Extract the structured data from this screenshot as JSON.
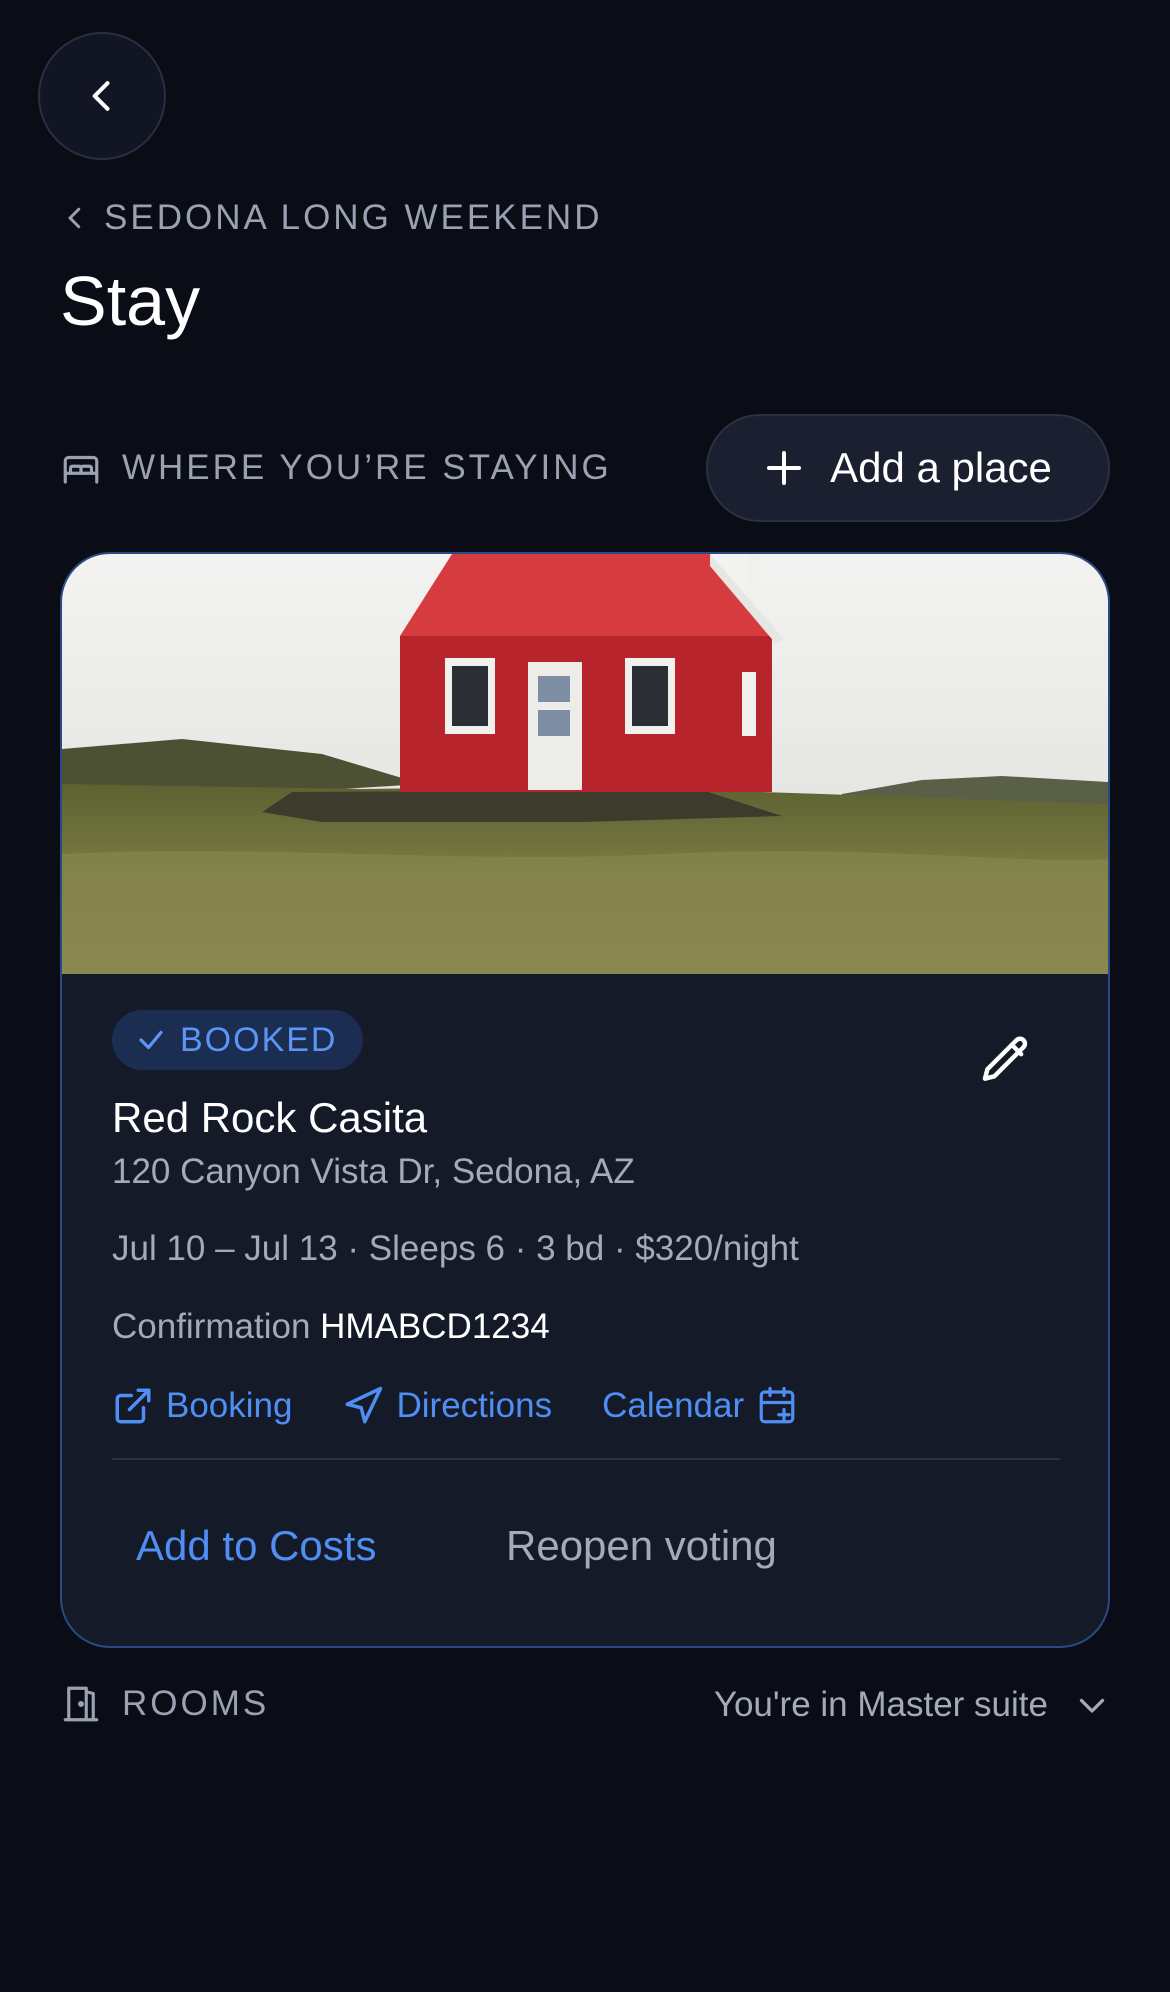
{
  "colors": {
    "background": "#0a0c16",
    "card": "#151a28",
    "card_border": "#2a4a86",
    "accent": "#4f8ef3",
    "muted": "#9aa1b1",
    "badge_bg": "#1c2d52"
  },
  "header": {
    "back_icon": "chevron-left-icon",
    "breadcrumb": "SEDONA LONG WEEKEND",
    "title": "Stay"
  },
  "stay_section": {
    "heading": "WHERE YOU’RE STAYING",
    "heading_icon": "bed-icon",
    "add_button_label": "Add a place",
    "add_button_icon": "plus-icon"
  },
  "stay_card": {
    "status": "BOOKED",
    "name": "Red Rock Casita",
    "address": "120 Canyon Vista Dr, Sedona, AZ",
    "details": "Jul 10 – Jul 13 · Sleeps 6 · 3 bd · $320/night",
    "confirmation_label": "Confirmation",
    "confirmation_code": "HMABCD1234",
    "links": {
      "booking": "Booking",
      "directions": "Directions",
      "calendar": "Calendar"
    },
    "actions": {
      "add_to_costs": "Add to Costs",
      "reopen_voting": "Reopen voting"
    }
  },
  "rooms_section": {
    "heading": "ROOMS",
    "heading_icon": "door-icon",
    "assignment": "You're in Master suite"
  }
}
